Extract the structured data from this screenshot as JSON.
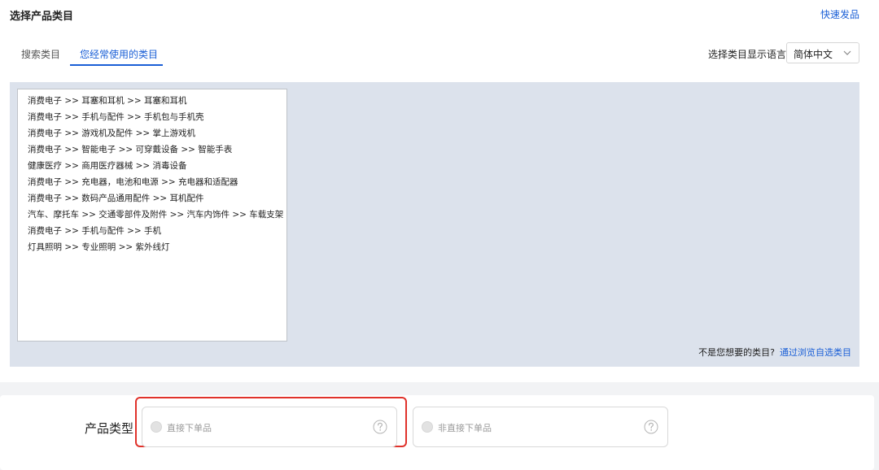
{
  "header": {
    "title": "选择产品类目",
    "quick_link": "快速发品"
  },
  "tabs": [
    {
      "label": "搜索类目"
    },
    {
      "label": "您经常使用的类目"
    }
  ],
  "language": {
    "label": "选择类目显示语言",
    "selected": "简体中文"
  },
  "categories": [
    "消费电子 >> 耳塞和耳机 >> 耳塞和耳机",
    "消费电子 >> 手机与配件 >> 手机包与手机壳",
    "消费电子 >> 游戏机及配件 >> 掌上游戏机",
    "消费电子 >> 智能电子 >> 可穿戴设备 >> 智能手表",
    "健康医疗 >> 商用医疗器械 >> 消毒设备",
    "消费电子 >> 充电器，电池和电源 >> 充电器和适配器",
    "消费电子 >> 数码产品通用配件 >> 耳机配件",
    "汽车、摩托车 >> 交通零部件及附件 >> 汽车内饰件 >> 车载支架",
    "消费电子 >> 手机与配件 >> 手机",
    "灯具照明 >> 专业照明 >> 紫外线灯"
  ],
  "hint": {
    "question": "不是您想要的类目?",
    "browse_link": "通过浏览自选类目"
  },
  "product_type": {
    "label": "产品类型",
    "options": [
      {
        "label": "直接下单品"
      },
      {
        "label": "非直接下单品"
      }
    ]
  },
  "colors": {
    "accent": "#1a5fd6",
    "highlight_border": "#e0322b",
    "category_area_bg": "#dce2ec"
  }
}
